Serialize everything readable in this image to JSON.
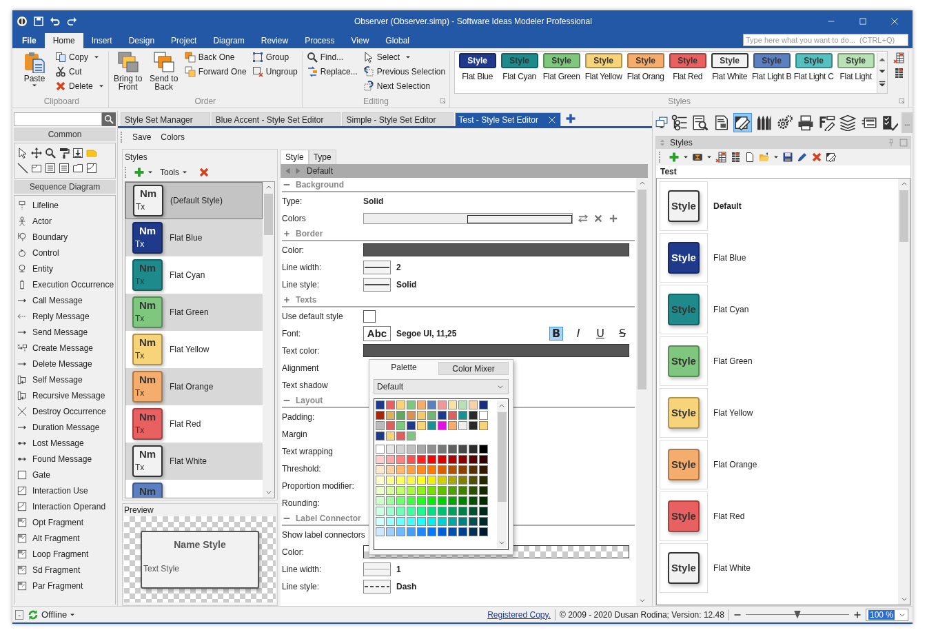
{
  "window": {
    "title": "Observer (Observer.simp) - Software Ideas Modeler Professional"
  },
  "ribbon_tabs": [
    {
      "label": "File",
      "selected": false
    },
    {
      "label": "Home",
      "selected": true
    },
    {
      "label": "Insert",
      "selected": false
    },
    {
      "label": "Design",
      "selected": false
    },
    {
      "label": "Project",
      "selected": false
    },
    {
      "label": "Diagram",
      "selected": false
    },
    {
      "label": "Review",
      "selected": false
    },
    {
      "label": "Process",
      "selected": false
    },
    {
      "label": "View",
      "selected": false
    },
    {
      "label": "Global",
      "selected": false
    }
  ],
  "command_search": {
    "placeholder": "Type here what you want to do...  (CTRL+Q)"
  },
  "ribbon_groups": [
    {
      "title": "Clipboard",
      "launcher": false,
      "columns": [
        {
          "kind": "large",
          "items": [
            {
              "label": "Paste",
              "dropdown": true
            }
          ]
        },
        {
          "kind": "small",
          "items": [
            {
              "label": "Copy",
              "dropdown": true
            },
            {
              "label": "Cut",
              "dropdown": false
            },
            {
              "label": "Delete",
              "dropdown": true
            }
          ]
        }
      ]
    },
    {
      "title": "Order",
      "launcher": false,
      "columns": [
        {
          "kind": "large",
          "items": [
            {
              "label": "Bring to Front",
              "dropdown": false
            }
          ]
        },
        {
          "kind": "large",
          "items": [
            {
              "label": "Send to Back",
              "dropdown": false
            }
          ]
        },
        {
          "kind": "small",
          "items": [
            {
              "label": "Back One",
              "dropdown": false
            },
            {
              "label": "Forward One",
              "dropdown": false
            }
          ]
        },
        {
          "kind": "small",
          "items": [
            {
              "label": "Group",
              "dropdown": false
            },
            {
              "label": "Ungroup",
              "dropdown": false
            }
          ]
        }
      ]
    },
    {
      "title": "Editing",
      "launcher": true,
      "columns": [
        {
          "kind": "small",
          "items": [
            {
              "label": "Find...",
              "dropdown": false
            },
            {
              "label": "Replace...",
              "dropdown": false
            }
          ]
        },
        {
          "kind": "small",
          "items": [
            {
              "label": "Select",
              "dropdown": true
            },
            {
              "label": "Previous Selection",
              "dropdown": false
            },
            {
              "label": "Next Selection",
              "dropdown": false
            }
          ]
        }
      ]
    }
  ],
  "style_gallery": {
    "title": "Styles",
    "items": [
      {
        "label": "Style",
        "caption": "Flat Blue",
        "color": "#1f3a8a"
      },
      {
        "label": "Style",
        "caption": "Flat Cyan",
        "color": "#1f8a8c"
      },
      {
        "label": "Style",
        "caption": "Flat Green",
        "color": "#7fc67f"
      },
      {
        "label": "Style",
        "caption": "Flat Yellow",
        "color": "#f7d37a"
      },
      {
        "label": "Style",
        "caption": "Flat Orang",
        "color": "#f5ad6e"
      },
      {
        "label": "Style",
        "caption": "Flat Red",
        "color": "#e8605f"
      },
      {
        "label": "Style",
        "caption": "Flat White",
        "color": "#f2f2f2"
      },
      {
        "label": "Style",
        "caption": "Flat Light B",
        "color": "#5b7fbf"
      },
      {
        "label": "Style",
        "caption": "Flat Light C",
        "color": "#56c0c0"
      },
      {
        "label": "Style",
        "caption": "Flat Light",
        "color": "#b8e2b5"
      }
    ]
  },
  "toolbox": {
    "common_title": "Common",
    "section_title": "Sequence Diagram",
    "items": [
      "Lifeline",
      "Actor",
      "Boundary",
      "Control",
      "Entity",
      "Execution Occurrence",
      "Call Message",
      "Reply Message",
      "Send Message",
      "Create Message",
      "Delete Message",
      "Self Message",
      "Recursive Message",
      "Destroy Occurrence",
      "Duration Message",
      "Lost Message",
      "Found Message",
      "Gate",
      "Interaction Use",
      "Interaction Operand",
      "Opt Fragment",
      "Alt Fragment",
      "Loop Fragment",
      "Sd Fragment",
      "Par Fragment"
    ]
  },
  "document_tabs": [
    {
      "label": "Style Set Manager",
      "selected": false
    },
    {
      "label": "Blue Accent - Style Set Editor",
      "selected": false
    },
    {
      "label": "Simple - Style Set Editor",
      "selected": false
    },
    {
      "label": "Test - Style Set Editor",
      "selected": true
    }
  ],
  "editor_toolbar": [
    "Save",
    "Colors"
  ],
  "styles_list": {
    "title": "Styles",
    "tools_label": "Tools",
    "items": [
      {
        "name": "(Default Style)",
        "swatch_title": "Nm",
        "swatch_text": "Tx",
        "color": "#f2f2f2",
        "selected": true
      },
      {
        "name": "Flat Blue",
        "swatch_title": "Nm",
        "swatch_text": "Tx",
        "color": "#1f3a8a",
        "selected": false
      },
      {
        "name": "Flat Cyan",
        "swatch_title": "Nm",
        "swatch_text": "Tx",
        "color": "#1f8a8c",
        "selected": false
      },
      {
        "name": "Flat Green",
        "swatch_title": "Nm",
        "swatch_text": "Tx",
        "color": "#7fc67f",
        "selected": false
      },
      {
        "name": "Flat Yellow",
        "swatch_title": "Nm",
        "swatch_text": "Tx",
        "color": "#f7d37a",
        "selected": false
      },
      {
        "name": "Flat Orange",
        "swatch_title": "Nm",
        "swatch_text": "Tx",
        "color": "#f5ad6e",
        "selected": false
      },
      {
        "name": "Flat Red",
        "swatch_title": "Nm",
        "swatch_text": "Tx",
        "color": "#e8605f",
        "selected": false
      },
      {
        "name": "Flat White",
        "swatch_title": "Nm",
        "swatch_text": "Tx",
        "color": "#f2f2f2",
        "selected": false
      },
      {
        "swatch_title": "Nm",
        "color": "#5b7fbf",
        "selected": false
      }
    ]
  },
  "preview": {
    "title": "Preview",
    "name_text": "Name Style",
    "body_text": "Text Style"
  },
  "property_editor": {
    "tabs": [
      {
        "label": "Style",
        "selected": true
      },
      {
        "label": "Type",
        "selected": false
      }
    ],
    "header": "Default",
    "sections": [
      {
        "title": "Background",
        "expanded": true,
        "rows": [
          {
            "label": "Type:",
            "kind": "text",
            "value": "Solid"
          },
          {
            "label": "Colors",
            "kind": "gradient"
          }
        ]
      },
      {
        "title": "Border",
        "expanded": false,
        "rows": [
          {
            "label": "Color:",
            "kind": "color",
            "color": "#555555"
          },
          {
            "label": "Line width:",
            "kind": "line-solid",
            "value": "2"
          },
          {
            "label": "Line style:",
            "kind": "line-solid",
            "value": "Solid"
          }
        ]
      },
      {
        "title": "Texts",
        "expanded": false,
        "rows": [
          {
            "label": "Use default style",
            "kind": "checkbox",
            "checked": false
          },
          {
            "label": "Font:",
            "kind": "font",
            "sample": "Abc",
            "value": "Segoe UI, 11,25",
            "toggles": [
              {
                "label": "B",
                "kind": "bold",
                "on": true
              },
              {
                "label": "I",
                "kind": "italic",
                "on": false
              },
              {
                "label": "U",
                "kind": "underline",
                "on": false
              },
              {
                "label": "S",
                "kind": "strike",
                "on": false
              }
            ]
          },
          {
            "label": "Text color:",
            "kind": "color",
            "color": "#555555"
          },
          {
            "label": "Alignment",
            "kind": "empty"
          },
          {
            "label": "Text shadow",
            "kind": "empty"
          }
        ]
      },
      {
        "title": "Layout",
        "expanded": true,
        "rows": [
          {
            "label": "Padding:",
            "kind": "empty"
          },
          {
            "label": "Margin",
            "kind": "empty"
          },
          {
            "label": "Text wrapping",
            "kind": "empty"
          },
          {
            "label": "Threshold:",
            "kind": "empty"
          },
          {
            "label": "Proportion modifier:",
            "kind": "empty"
          },
          {
            "label": "Rounding:",
            "kind": "empty"
          }
        ]
      },
      {
        "title": "Label Connector",
        "expanded": true,
        "rows": [
          {
            "label": "Show label connectors",
            "kind": "empty"
          },
          {
            "label": "Color:",
            "kind": "transparent"
          },
          {
            "label": "Line width:",
            "kind": "line-thin",
            "value": "1"
          },
          {
            "label": "Line style:",
            "kind": "line-dash",
            "value": "Dash"
          }
        ]
      }
    ]
  },
  "color_popup": {
    "tabs": [
      {
        "label": "Palette",
        "selected": true
      },
      {
        "label": "Color Mixer",
        "selected": false
      }
    ],
    "palette": "Default",
    "rows": [
      {
        "cells": [
          {
            "color": "#1f3a8a"
          },
          {
            "color": "#e8605f"
          },
          {
            "color": "#f7d37a"
          },
          {
            "color": "#7fc67f"
          },
          {
            "color": "#f5ad6e"
          },
          {
            "color": "#5b7fbf"
          },
          {
            "color": "#ee9a9a"
          },
          {
            "color": "#f7e3a8"
          },
          {
            "color": "#b8e2b5"
          },
          {
            "color": "#f9d2a8"
          },
          {
            "color": "#1a2f7a"
          }
        ]
      },
      {
        "cells": [
          {
            "color": "#a8260c"
          },
          {
            "color": "#d9b25e"
          },
          {
            "color": "#62a862"
          },
          {
            "color": "#d9924f"
          },
          {
            "color": "#f5c870"
          },
          {
            "color": "#70b870"
          },
          {
            "color": "#1e3a8a"
          },
          {
            "color": "#e06060"
          },
          {
            "color": "#1a9090"
          },
          {
            "color": "#2a2a2a"
          },
          {
            "color": "#ffffff"
          }
        ]
      },
      {
        "cells": [
          {
            "color": "#bbbbbb"
          },
          {
            "color": "#e06060"
          },
          {
            "color": "#7fc67f"
          },
          {
            "color": "#1f3a8a"
          },
          {
            "color": "#f7d37a"
          },
          {
            "color": "#1a9090"
          },
          {
            "color": "#e010e0"
          },
          {
            "color": "#f5ad6e"
          },
          {
            "color": "#eeeeee"
          },
          {
            "color": "#2a2a2a"
          },
          {
            "color": "#f7d37a"
          }
        ]
      },
      {
        "cells": [
          {
            "color": "#1f3a8a"
          },
          {
            "color": "#f7d37a"
          },
          {
            "color": "#e06060"
          },
          {
            "color": "#7fc67f"
          }
        ]
      },
      {
        "cells": [
          {
            "color": "#ffffff"
          },
          {
            "color": "#e8e8e8"
          },
          {
            "color": "#d4d4d4"
          },
          {
            "color": "#c0c0c0"
          },
          {
            "color": "#a8a8a8"
          },
          {
            "color": "#909090"
          },
          {
            "color": "#787878"
          },
          {
            "color": "#606060"
          },
          {
            "color": "#484848"
          },
          {
            "color": "#2a2a2a"
          },
          {
            "color": "#000000"
          }
        ]
      },
      {
        "cells": [
          {
            "color": "#ffd0d0"
          },
          {
            "color": "#ffa8a8"
          },
          {
            "color": "#ff8080"
          },
          {
            "color": "#ff5050"
          },
          {
            "color": "#ff2020"
          },
          {
            "color": "#ff0000"
          },
          {
            "color": "#d80000"
          },
          {
            "color": "#b00000"
          },
          {
            "color": "#880000"
          },
          {
            "color": "#580000"
          },
          {
            "color": "#300000"
          }
        ]
      },
      {
        "cells": [
          {
            "color": "#ffe8d0"
          },
          {
            "color": "#ffd0a0"
          },
          {
            "color": "#ffb870"
          },
          {
            "color": "#ffa040"
          },
          {
            "color": "#ff8c20"
          },
          {
            "color": "#ff7800"
          },
          {
            "color": "#d86000"
          },
          {
            "color": "#b05000"
          },
          {
            "color": "#884000"
          },
          {
            "color": "#583000"
          },
          {
            "color": "#301800"
          }
        ]
      },
      {
        "cells": [
          {
            "color": "#ffffd0"
          },
          {
            "color": "#ffff90"
          },
          {
            "color": "#ffff60"
          },
          {
            "color": "#f8f840"
          },
          {
            "color": "#ffff20"
          },
          {
            "color": "#f0f000"
          },
          {
            "color": "#d0d000"
          },
          {
            "color": "#a8a800"
          },
          {
            "color": "#808000"
          },
          {
            "color": "#505000"
          },
          {
            "color": "#282800"
          }
        ]
      },
      {
        "cells": [
          {
            "color": "#f0ffd0"
          },
          {
            "color": "#d8ffa0"
          },
          {
            "color": "#c0ff70"
          },
          {
            "color": "#a8f840"
          },
          {
            "color": "#90f020"
          },
          {
            "color": "#78e000"
          },
          {
            "color": "#60c000"
          },
          {
            "color": "#50a000"
          },
          {
            "color": "#408000"
          },
          {
            "color": "#285000"
          },
          {
            "color": "#142800"
          }
        ]
      },
      {
        "cells": [
          {
            "color": "#d0ffd0"
          },
          {
            "color": "#a0ffa0"
          },
          {
            "color": "#70ff70"
          },
          {
            "color": "#40ff40"
          },
          {
            "color": "#20ff20"
          },
          {
            "color": "#00f000"
          },
          {
            "color": "#00d000"
          },
          {
            "color": "#00a800"
          },
          {
            "color": "#008000"
          },
          {
            "color": "#005000"
          },
          {
            "color": "#002800"
          }
        ]
      },
      {
        "cells": [
          {
            "color": "#d0ffe8"
          },
          {
            "color": "#a0ffd0"
          },
          {
            "color": "#70ffb8"
          },
          {
            "color": "#40ffa0"
          },
          {
            "color": "#20f890"
          },
          {
            "color": "#00e080"
          },
          {
            "color": "#00c070"
          },
          {
            "color": "#00a060"
          },
          {
            "color": "#008048"
          },
          {
            "color": "#005030"
          },
          {
            "color": "#002818"
          }
        ]
      },
      {
        "cells": [
          {
            "color": "#d0ffff"
          },
          {
            "color": "#a0ffff"
          },
          {
            "color": "#70ffff"
          },
          {
            "color": "#40ffff"
          },
          {
            "color": "#20ffff"
          },
          {
            "color": "#00f0f0"
          },
          {
            "color": "#00d0d0"
          },
          {
            "color": "#00a8a8"
          },
          {
            "color": "#008080"
          },
          {
            "color": "#005050"
          },
          {
            "color": "#002828"
          }
        ]
      },
      {
        "cells": [
          {
            "color": "#d0e8ff"
          },
          {
            "color": "#a0d0ff"
          },
          {
            "color": "#70b8ff"
          },
          {
            "color": "#40a0ff"
          },
          {
            "color": "#2088ff"
          },
          {
            "color": "#0078ff"
          },
          {
            "color": "#0060d8"
          },
          {
            "color": "#0050b0"
          },
          {
            "color": "#004088"
          },
          {
            "color": "#003058"
          },
          {
            "color": "#001830"
          }
        ]
      }
    ]
  },
  "view_toolbar": {
    "buttons": [
      {
        "selected": false
      },
      {
        "selected": false
      },
      {
        "selected": false
      },
      {
        "selected": true
      },
      {
        "selected": false
      },
      {
        "selected": false
      },
      {
        "selected": false
      },
      {
        "selected": false
      },
      {
        "selected": false
      },
      {
        "selected": false
      },
      {
        "selected": false
      }
    ],
    "more": "..."
  },
  "styles_panel": {
    "title": "Styles",
    "set_name": "Test",
    "items": [
      {
        "label": "Style",
        "name": "Default",
        "color": "#f2f2f2",
        "default": true
      },
      {
        "label": "Style",
        "name": "Flat Blue",
        "color": "#1f3a8a",
        "default": false
      },
      {
        "label": "Style",
        "name": "Flat Cyan",
        "color": "#1f8a8c",
        "default": false
      },
      {
        "label": "Style",
        "name": "Flat Green",
        "color": "#7fc67f",
        "default": false
      },
      {
        "label": "Style",
        "name": "Flat Yellow",
        "color": "#f7d37a",
        "default": false
      },
      {
        "label": "Style",
        "name": "Flat Orange",
        "color": "#f5ad6e",
        "default": false
      },
      {
        "label": "Style",
        "name": "Flat Red",
        "color": "#e8605f",
        "default": false
      },
      {
        "label": "Style",
        "name": "Flat White",
        "color": "#f2f2f2",
        "default": false
      }
    ]
  },
  "status_bar": {
    "collapse": "-",
    "connection": "Offline",
    "link": "Registered Copy.",
    "copyright": "© 2009 - 2020 Dusan Rodina; Version: 12.48",
    "zoom": {
      "level": 0.5,
      "value": "100 %"
    }
  }
}
